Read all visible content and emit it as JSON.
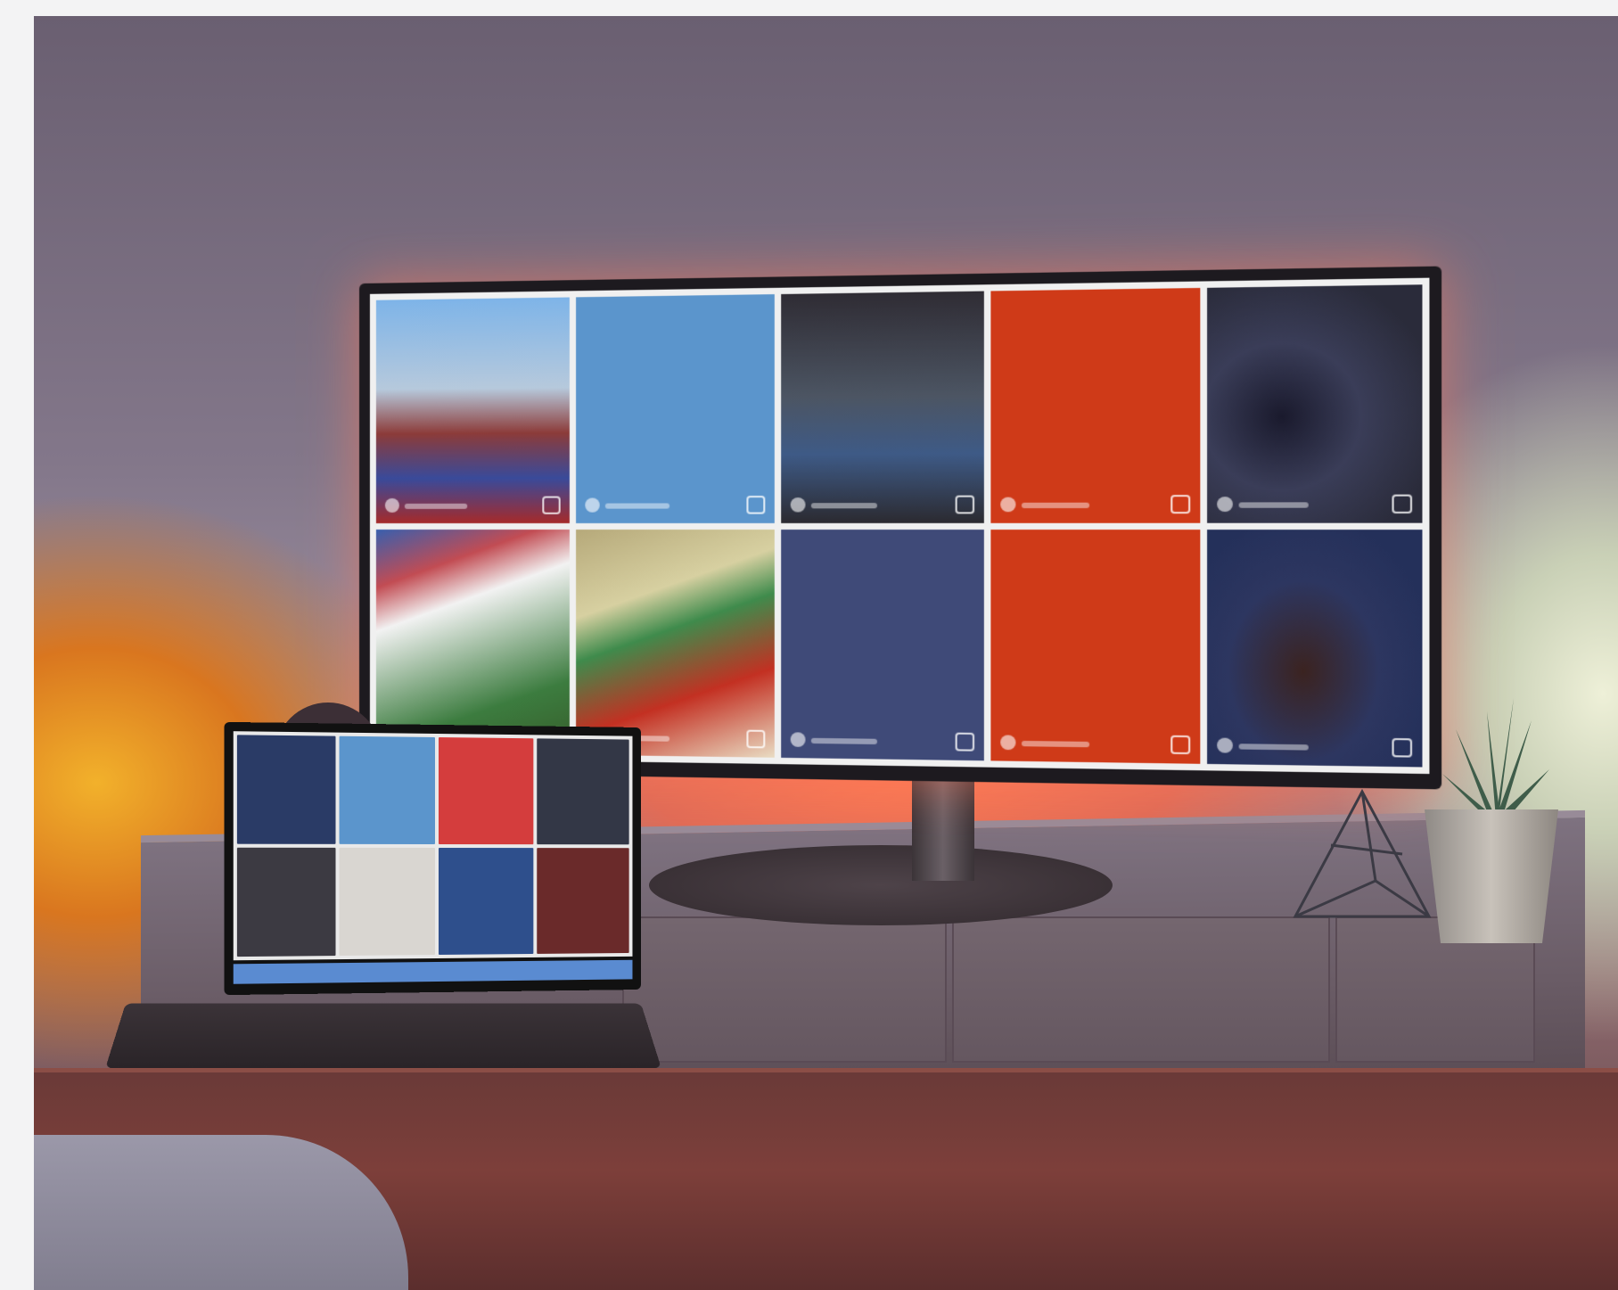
{
  "scene": {
    "subject": "monitor-laptop-desk-setup"
  },
  "monitor_tiles": [
    {
      "kind": "photo",
      "style": "ph1"
    },
    {
      "kind": "text",
      "style": "blue",
      "caption": ""
    },
    {
      "kind": "photo",
      "style": "ph2"
    },
    {
      "kind": "text",
      "style": "orange",
      "caption": ""
    },
    {
      "kind": "photo",
      "style": "ph3"
    },
    {
      "kind": "photo",
      "style": "ph4"
    },
    {
      "kind": "photo",
      "style": "ph5"
    },
    {
      "kind": "text",
      "style": "navy",
      "caption": ""
    },
    {
      "kind": "text",
      "style": "orange",
      "caption": ""
    },
    {
      "kind": "photo",
      "style": "ph6"
    }
  ],
  "laptop_tiles": [
    "#2a3b66",
    "#5b95cc",
    "#d43d3d",
    "#333746",
    "#3c3a42",
    "#d9d6d1",
    "#2e4f8c",
    "#6a2a2a"
  ],
  "colors": {
    "tile_blue": "#5b95cc",
    "tile_orange": "#cf3a18",
    "tile_navy": "#3f4a78",
    "ambient_left": "#f2b12b",
    "ambient_center": "#ff7a52",
    "ambient_right": "#eef0d8"
  }
}
